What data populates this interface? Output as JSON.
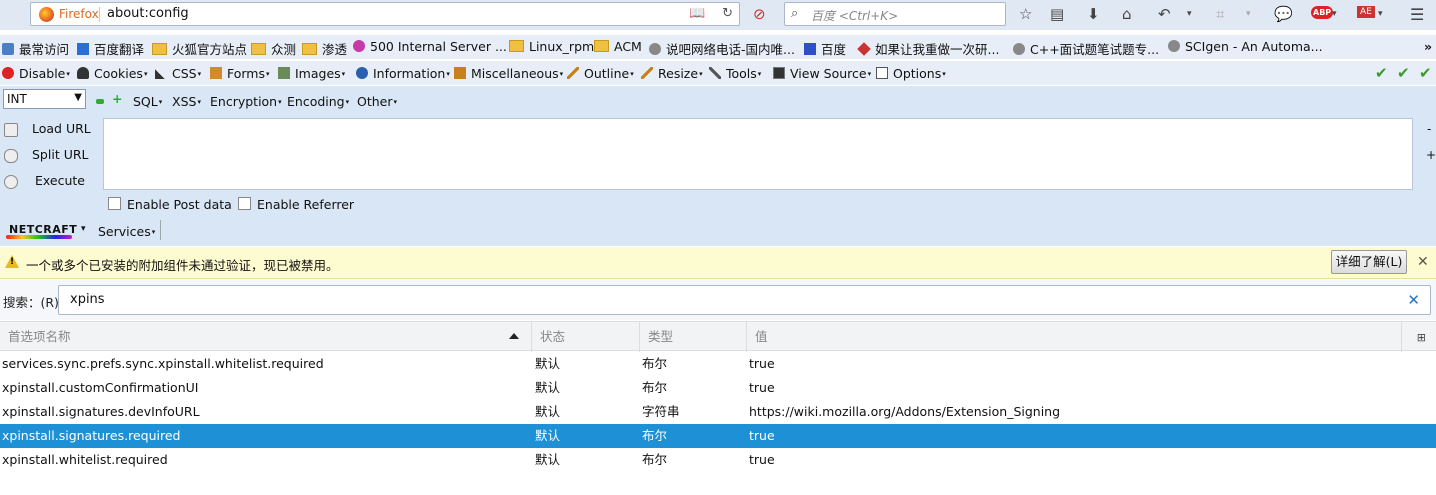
{
  "nav": {
    "brand": "Firefox",
    "url": "about:config",
    "search_placeholder": "百度 <Ctrl+K>"
  },
  "bookmarks": [
    {
      "label": "最常访问",
      "icon": "gear-icon"
    },
    {
      "label": "百度翻译",
      "icon": "translate-icon"
    },
    {
      "label": "火狐官方站点",
      "icon": "folder-icon"
    },
    {
      "label": "众测",
      "icon": "folder-icon"
    },
    {
      "label": "渗透",
      "icon": "folder-icon"
    },
    {
      "label": "500 Internal Server ...",
      "icon": "site-icon"
    },
    {
      "label": "Linux_rpm",
      "icon": "folder-icon"
    },
    {
      "label": "ACM",
      "icon": "folder-icon"
    },
    {
      "label": "说吧网络电话-国内唯...",
      "icon": "globe-icon"
    },
    {
      "label": "百度",
      "icon": "baidu-icon"
    },
    {
      "label": "如果让我重做一次研...",
      "icon": "site-icon"
    },
    {
      "label": "C++面试题笔试题专...",
      "icon": "globe-icon"
    },
    {
      "label": "SCIgen - An Automa...",
      "icon": "globe-icon"
    }
  ],
  "bookmarks_overflow": "»",
  "webdev": [
    {
      "label": "Disable",
      "icon": "disable-icon"
    },
    {
      "label": "Cookies",
      "icon": "cookies-icon"
    },
    {
      "label": "CSS",
      "icon": "css-icon"
    },
    {
      "label": "Forms",
      "icon": "forms-icon"
    },
    {
      "label": "Images",
      "icon": "images-icon"
    },
    {
      "label": "Information",
      "icon": "information-icon"
    },
    {
      "label": "Miscellaneous",
      "icon": "miscellaneous-icon"
    },
    {
      "label": "Outline",
      "icon": "outline-icon"
    },
    {
      "label": "Resize",
      "icon": "resize-icon"
    },
    {
      "label": "Tools",
      "icon": "tools-icon"
    },
    {
      "label": "View Source",
      "icon": "view-source-icon"
    },
    {
      "label": "Options",
      "icon": "options-icon"
    }
  ],
  "hackbar": {
    "select_value": "INT",
    "menus": [
      "SQL",
      "XSS",
      "Encryption",
      "Encoding",
      "Other"
    ],
    "actions": [
      "Load URL",
      "Split URL",
      "Execute"
    ],
    "enable_post": "Enable Post data",
    "enable_referrer": "Enable Referrer",
    "netcraft_logo": "NETCRAFT",
    "services": "Services"
  },
  "notification": {
    "text": "一个或多个已安装的附加组件未通过验证，现已被禁用。",
    "button": "详细了解(L)"
  },
  "search": {
    "label": "搜索：(R)",
    "value": "xpins"
  },
  "table": {
    "columns": [
      "首选项名称",
      "状态",
      "类型",
      "值"
    ],
    "rows": [
      {
        "name": "services.sync.prefs.sync.xpinstall.whitelist.required",
        "status": "默认",
        "type": "布尔",
        "value": "true"
      },
      {
        "name": "xpinstall.customConfirmationUI",
        "status": "默认",
        "type": "布尔",
        "value": "true"
      },
      {
        "name": "xpinstall.signatures.devInfoURL",
        "status": "默认",
        "type": "字符串",
        "value": "https://wiki.mozilla.org/Addons/Extension_Signing"
      },
      {
        "name": "xpinstall.signatures.required",
        "status": "默认",
        "type": "布尔",
        "value": "true",
        "selected": true
      },
      {
        "name": "xpinstall.whitelist.required",
        "status": "默认",
        "type": "布尔",
        "value": "true"
      }
    ]
  }
}
